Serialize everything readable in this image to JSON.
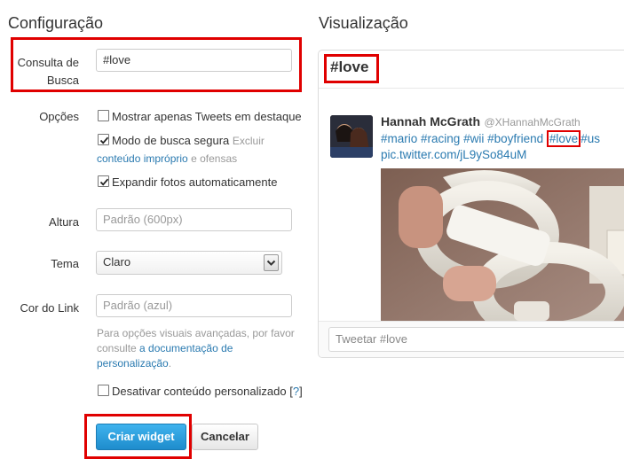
{
  "left_panel": {
    "title": "Configuração",
    "search_query": {
      "label_line1": "Consulta de",
      "label_line2": "Busca",
      "value": "#love"
    },
    "options": {
      "label": "Opções",
      "top_tweets": {
        "label": "Mostrar apenas Tweets em destaque",
        "checked": false
      },
      "safe_search": {
        "label": "Modo de busca segura",
        "hint1": "Excluir",
        "link": "conteúdo impróprio",
        "hint2": "e ofensas",
        "checked": true
      },
      "expand_photos": {
        "label": "Expandir fotos automaticamente",
        "checked": true
      }
    },
    "height": {
      "label": "Altura",
      "placeholder": "Padrão (600px)"
    },
    "theme": {
      "label": "Tema",
      "value": "Claro"
    },
    "link_color": {
      "label": "Cor do Link",
      "placeholder": "Padrão (azul)"
    },
    "help": {
      "line1": "Para opções visuais avançadas, por favor",
      "line2_prefix": "consulte ",
      "line2_link": "a documentação de",
      "line3_link": "personalização",
      "line3_suffix": "."
    },
    "disable_personalized": {
      "label": "Desativar conteúdo personalizado",
      "help_open": "[",
      "help_link": "?",
      "help_close": "]",
      "checked": false
    },
    "create_button": "Criar widget",
    "cancel_button": "Cancelar"
  },
  "preview": {
    "title": "Visualização",
    "widget_title": "#love",
    "tweet": {
      "name": "Hannah McGrath",
      "handle": "@XHannahMcGrath",
      "hashtags": [
        "#mario",
        "#racing",
        "#wii",
        "#boyfriend",
        "#love",
        "#us"
      ],
      "link": "pic.twitter.com/jL9ySo84uM"
    },
    "compose_placeholder": "Tweetar #love"
  },
  "colors": {
    "highlight": "#e00000",
    "link": "#2a7ab0",
    "button_primary": "#2b9fd9"
  }
}
